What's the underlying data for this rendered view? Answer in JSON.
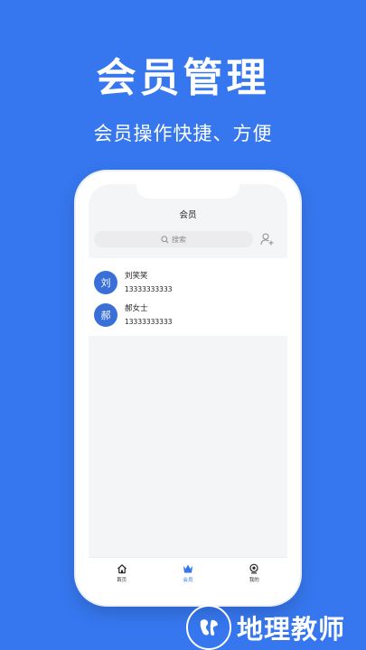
{
  "promo": {
    "title": "会员管理",
    "subtitle": "会员操作快捷、方便"
  },
  "app": {
    "nav_title": "会员",
    "search": {
      "placeholder": "搜索",
      "icon": "search-icon"
    },
    "add_member_icon": "add-user-icon",
    "members": [
      {
        "avatar_text": "刘",
        "name": "刘笑笑",
        "phone": "13333333333"
      },
      {
        "avatar_text": "郝",
        "name": "郝女士",
        "phone": "13333333333"
      }
    ],
    "tabs": [
      {
        "label": "首页",
        "icon": "home-icon",
        "active": false
      },
      {
        "label": "会员",
        "icon": "crown-icon",
        "active": true
      },
      {
        "label": "我的",
        "icon": "profile-icon",
        "active": false
      }
    ]
  },
  "watermark": {
    "text": "地理教师"
  },
  "colors": {
    "background": "#3677ef",
    "avatar": "#3a6fd8",
    "active_tab": "#3677ef"
  }
}
